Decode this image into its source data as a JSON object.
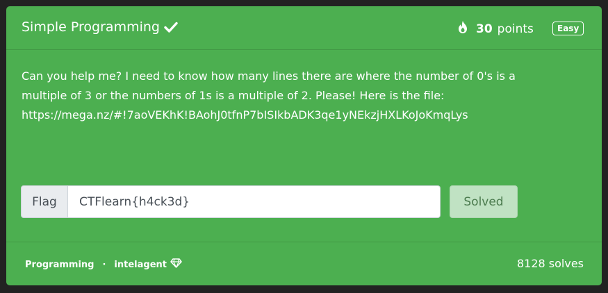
{
  "header": {
    "title": "Simple Programming",
    "points_value": "30",
    "points_label": "points",
    "difficulty": "Easy"
  },
  "description": {
    "lines": [
      "Can you help me? I need to know how many lines there are where the number of 0's is a",
      "multiple of 3 or the numbers of 1s is a multiple of 2. Please! Here is the file:",
      "https://mega.nz/#!7aoVEKhK!BAohJ0tfnP7bISIkbADK3qe1yNEkzjHXLKoJoKmqLys"
    ]
  },
  "flag_form": {
    "addon_label": "Flag",
    "input_value": "CTFlearn{h4ck3d}",
    "button_label": "Solved"
  },
  "footer": {
    "category": "Programming",
    "separator": "·",
    "author": "intelagent",
    "solves": "8128 solves"
  },
  "colors": {
    "card_bg": "#4caf50",
    "page_bg": "#222222",
    "solved_button_bg": "#c0e2c3"
  },
  "icons": [
    "check-icon",
    "fire-icon",
    "gem-icon"
  ]
}
